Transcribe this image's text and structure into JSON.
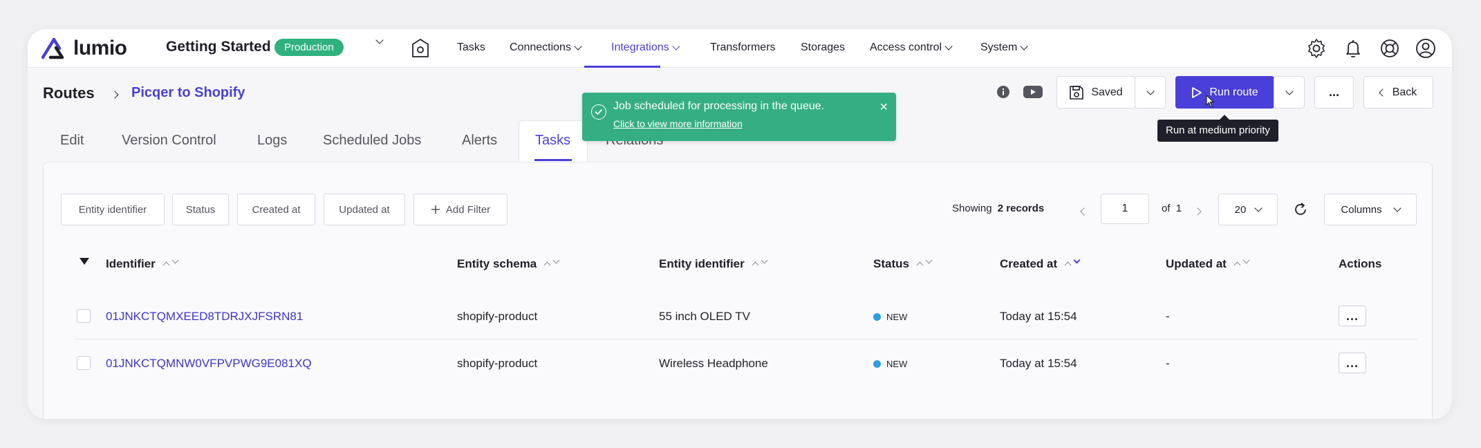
{
  "brand": {
    "logo_text": "lumio",
    "accent": "#4a3fd8",
    "success": "#36ae83"
  },
  "env": {
    "title": "Getting Started",
    "badge": "Production"
  },
  "nav": {
    "tasks": "Tasks",
    "connections": "Connections",
    "integrations": "Integrations",
    "transformers": "Transformers",
    "storages": "Storages",
    "access_control": "Access control",
    "system": "System"
  },
  "breadcrumb": {
    "root": "Routes",
    "leaf": "Picqer to Shopify"
  },
  "toolbar": {
    "saved_label": "Saved",
    "run_label": "Run route",
    "more_label": "...",
    "back_label": "Back"
  },
  "tooltip": {
    "text": "Run at medium priority"
  },
  "toast": {
    "title": "Job scheduled for processing in the queue.",
    "link": "Click to view more information",
    "close": "×"
  },
  "tabs": {
    "edit": "Edit",
    "version_control": "Version Control",
    "logs": "Logs",
    "scheduled_jobs": "Scheduled Jobs",
    "alerts": "Alerts",
    "tasks": "Tasks",
    "relations": "Relations"
  },
  "filters": {
    "entity_identifier": "Entity identifier",
    "status": "Status",
    "created_at": "Created at",
    "updated_at": "Updated at",
    "add_filter": "Add Filter"
  },
  "pagination": {
    "showing_label": "Showing",
    "records": "2 records",
    "page": "1",
    "of_label": "of",
    "total_pages": "1",
    "per_page": "20",
    "columns_label": "Columns"
  },
  "table": {
    "headers": {
      "identifier": "Identifier",
      "entity_schema": "Entity schema",
      "entity_identifier": "Entity identifier",
      "status": "Status",
      "created_at": "Created at",
      "updated_at": "Updated at",
      "actions": "Actions"
    },
    "rows": [
      {
        "identifier": "01JNKCTQMXEED8TDRJXJFSRN81",
        "entity_schema": "shopify-product",
        "entity_identifier": "55 inch OLED TV",
        "status": "NEW",
        "created_at": "Today at 15:54",
        "updated_at": "-",
        "action": "..."
      },
      {
        "identifier": "01JNKCTQMNW0VFPVPWG9E081XQ",
        "entity_schema": "shopify-product",
        "entity_identifier": "Wireless Headphone",
        "status": "NEW",
        "created_at": "Today at 15:54",
        "updated_at": "-",
        "action": "..."
      }
    ]
  }
}
